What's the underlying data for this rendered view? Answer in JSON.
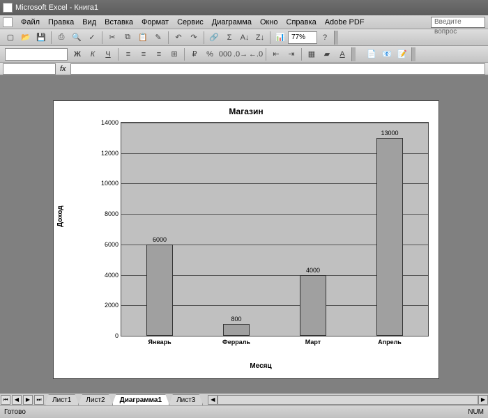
{
  "app_title": "Microsoft Excel - Книга1",
  "help_placeholder": "Введите вопрос",
  "menus": [
    "Файл",
    "Правка",
    "Вид",
    "Вставка",
    "Формат",
    "Сервис",
    "Диаграмма",
    "Окно",
    "Справка",
    "Adobe PDF"
  ],
  "zoom": "77%",
  "fx_label": "fx",
  "status_ready": "Готово",
  "status_right": "NUM",
  "sheet_tabs": [
    "Лист1",
    "Лист2",
    "Диаграмма1",
    "Лист3"
  ],
  "active_tab_index": 2,
  "chart_data": {
    "type": "bar",
    "title": "Магазин",
    "xlabel": "Месяц",
    "ylabel": "Доход",
    "categories": [
      "Январь",
      "Ферраль",
      "Март",
      "Апрель"
    ],
    "values": [
      6000,
      800,
      4000,
      13000
    ],
    "ylim": [
      0,
      14000
    ],
    "ytick_step": 2000,
    "grid": true
  }
}
